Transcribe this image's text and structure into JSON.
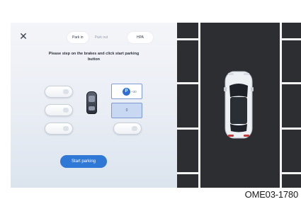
{
  "header": {
    "close_icon": "close-icon",
    "tabs": [
      {
        "label": "Park in",
        "active": true
      },
      {
        "label": "Park out",
        "active": false
      }
    ],
    "rspa_label": "HPA"
  },
  "instruction": "Please step on the brakes and click start parking button",
  "slots": {
    "selected_top_label": "+30",
    "selected_bottom_label": "0"
  },
  "start_button_label": "Start parking",
  "caption": "OME03-1780",
  "colors": {
    "accent": "#2f78d6",
    "panel_bg": "#eef1f6",
    "asphalt": "#2c2e32",
    "line": "#f3f3f3"
  }
}
